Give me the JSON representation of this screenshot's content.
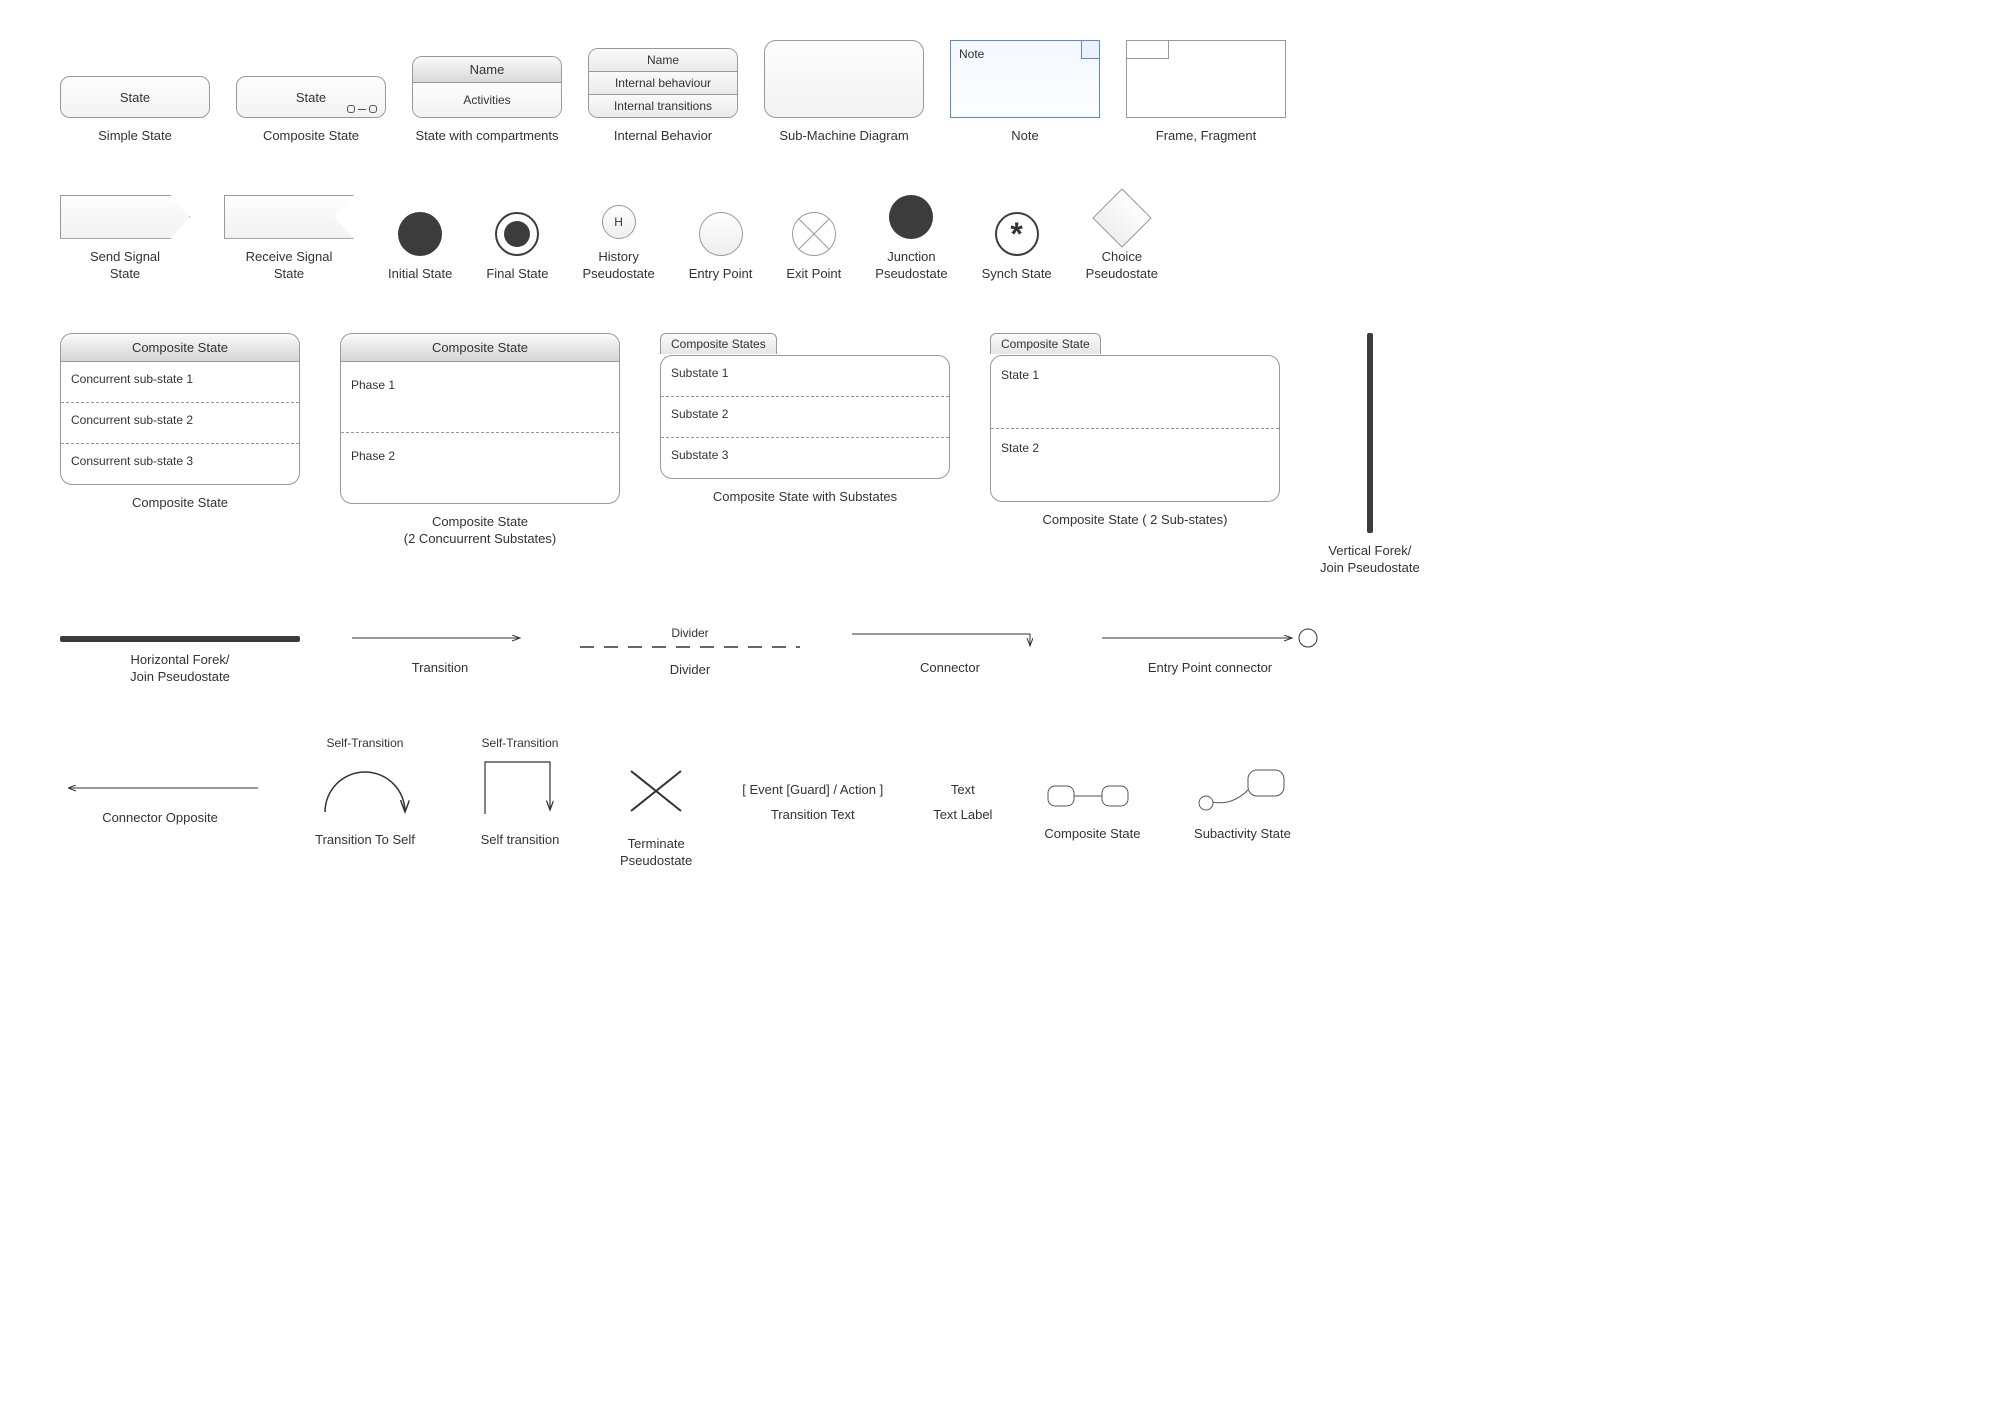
{
  "row1": {
    "simple": {
      "label": "State",
      "caption": "Simple State"
    },
    "composite": {
      "label": "State",
      "caption": "Composite State"
    },
    "comp_comp": {
      "name": "Name",
      "body": "Activities",
      "caption": "State with compartments"
    },
    "internal": {
      "name": "Name",
      "r1": "Internal behaviour",
      "r2": "Internal transitions",
      "caption": "Internal Behavior"
    },
    "submachine": {
      "caption": "Sub-Machine Diagram"
    },
    "note": {
      "text": "Note",
      "caption": "Note"
    },
    "frame": {
      "caption": "Frame, Fragment"
    }
  },
  "row2": {
    "send": {
      "caption": "Send Signal\nState"
    },
    "recv": {
      "caption": "Receive Signal\nState"
    },
    "initial": {
      "caption": "Initial State"
    },
    "final": {
      "caption": "Final State"
    },
    "history": {
      "label": "H",
      "caption": "History\nPseudostate"
    },
    "entry": {
      "caption": "Entry Point"
    },
    "exit": {
      "caption": "Exit Point"
    },
    "junction": {
      "caption": "Junction\nPseudostate"
    },
    "synch": {
      "glyph": "*",
      "caption": "Synch State"
    },
    "choice": {
      "caption": "Choice\nPseudostate"
    }
  },
  "row3": {
    "c1": {
      "title": "Composite State",
      "r1": "Concurrent sub-state 1",
      "r2": "Concurrent sub-state 2",
      "r3": "Consurrent sub-state 3",
      "caption": "Composite State"
    },
    "c2": {
      "title": "Composite State",
      "r1": "Phase 1",
      "r2": "Phase 2",
      "caption": "Composite State\n(2 Concuurrent Substates)"
    },
    "c3": {
      "tab": "Composite States",
      "r1": "Substate 1",
      "r2": "Substate 2",
      "r3": "Substate 3",
      "caption": "Composite State with Substates"
    },
    "c4": {
      "tab": "Composite State",
      "r1": "State 1",
      "r2": "State 2",
      "caption": "Composite State ( 2 Sub-states)"
    },
    "vfork": {
      "caption": "Vertical Forek/\nJoin Pseudostate"
    }
  },
  "row4": {
    "hfork": {
      "caption": "Horizontal Forek/\nJoin Pseudostate"
    },
    "trans": {
      "caption": "Transition"
    },
    "divider": {
      "label": "Divider",
      "caption": "Divider"
    },
    "conn": {
      "caption": "Connector"
    },
    "entryc": {
      "caption": "Entry Point connector"
    }
  },
  "row5": {
    "connop": {
      "caption": "Connector Opposite"
    },
    "toself": {
      "label": "Self-Transition",
      "caption": "Transition To Self"
    },
    "selft": {
      "label": "Self-Transition",
      "caption": "Self transition"
    },
    "term": {
      "caption": "Terminate\nPseudostate"
    },
    "ttext": {
      "label": "[ Event [Guard] / Action ]",
      "caption": "Transition Text"
    },
    "tlabel": {
      "label": "Text",
      "caption": "Text Label"
    },
    "compst": {
      "caption": "Composite State"
    },
    "subact": {
      "caption": "Subactivity State"
    }
  }
}
